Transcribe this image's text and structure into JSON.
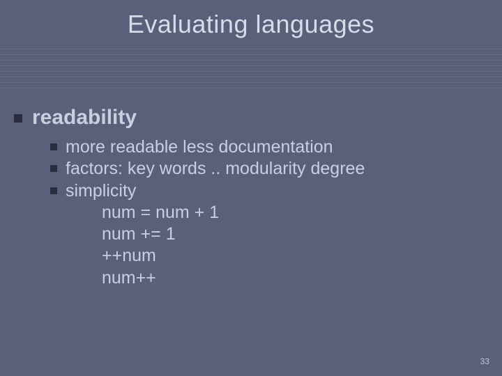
{
  "title": "Evaluating languages",
  "level1": "readability",
  "level2": [
    "more readable less documentation",
    "factors: key words .. modularity degree",
    "simplicity"
  ],
  "sublines": [
    "num = num + 1",
    "num += 1",
    "++num",
    "num++"
  ],
  "page_number": "33"
}
